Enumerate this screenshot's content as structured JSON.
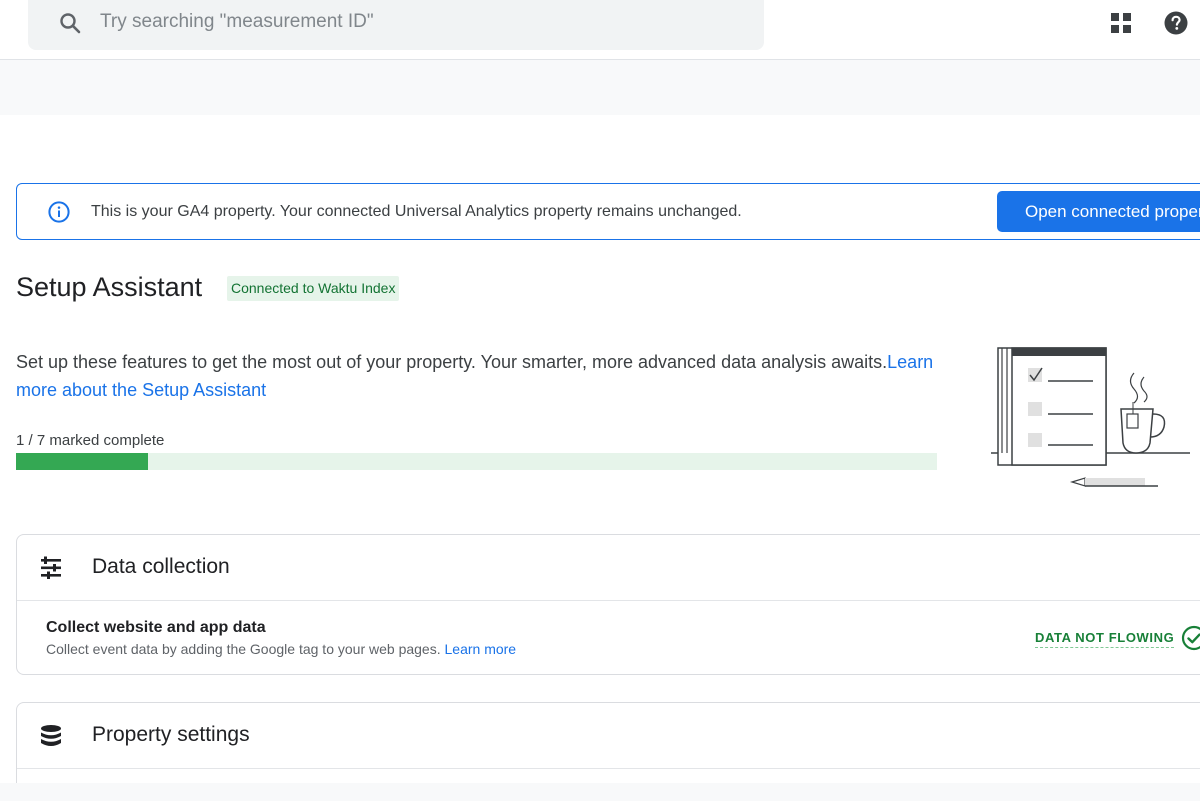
{
  "search": {
    "placeholder": "Try searching \"measurement ID\"",
    "icon": "search-icon"
  },
  "topbar_icons": [
    "apps-icon",
    "help-icon"
  ],
  "banner": {
    "text": "This is your GA4 property. Your connected Universal Analytics property remains unchanged.",
    "button_label": "Open connected property",
    "icon": "info-icon"
  },
  "setup": {
    "title": "Setup Assistant",
    "chip": "Connected to Waktu Index",
    "description": "Set up these features to get the most out of your property. Your smarter, more advanced data analysis awaits.",
    "learn_more": "Learn more about the Setup Assistant",
    "progress_label": "1 / 7 marked complete",
    "progress_completed": 1,
    "progress_total": 7
  },
  "sections": [
    {
      "title": "Data collection",
      "icon": "data-collection-icon",
      "task": {
        "title": "Collect website and app data",
        "description": "Collect event data by adding the Google tag to your web pages.",
        "learn_more": "Learn more",
        "status": "DATA NOT FLOWING",
        "status_icon": "check-circle-icon"
      }
    },
    {
      "title": "Property settings",
      "icon": "database-icon"
    }
  ],
  "colors": {
    "primary": "#1a73e8",
    "progress_fill": "#34a853",
    "progress_track": "#e6f4ea",
    "chip_bg": "#e6f4ea",
    "chip_text": "#137333",
    "status_green": "#188038"
  }
}
